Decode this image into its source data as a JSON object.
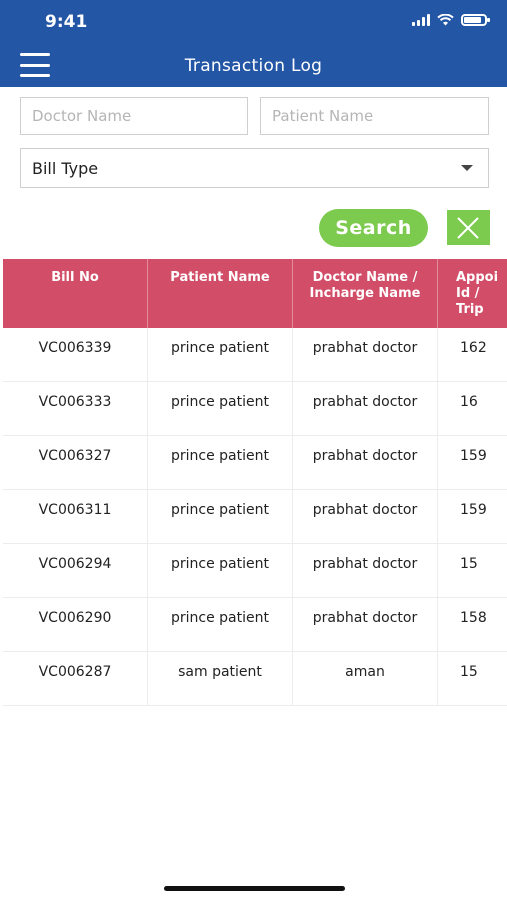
{
  "status": {
    "time": "9:41"
  },
  "header": {
    "title": "Transaction Log"
  },
  "filters": {
    "doctor_placeholder": "Doctor Name",
    "patient_placeholder": "Patient Name",
    "bill_type": "Bill Type"
  },
  "actions": {
    "search_label": "Search"
  },
  "colors": {
    "header": "#2456a6",
    "table_header": "#d24d68",
    "action_green": "#7ccb4e"
  },
  "table": {
    "columns": [
      "Bill No",
      "Patient Name",
      "Doctor Name / Incharge Name",
      "Appoi Id / Trip"
    ],
    "rows": [
      [
        "VC006339",
        "prince patient",
        "prabhat doctor",
        "162"
      ],
      [
        "VC006333",
        "prince patient",
        "prabhat doctor",
        "16"
      ],
      [
        "VC006327",
        "prince patient",
        "prabhat doctor",
        "159"
      ],
      [
        "VC006311",
        "prince patient",
        "prabhat doctor",
        "159"
      ],
      [
        "VC006294",
        "prince patient",
        "prabhat doctor",
        "15"
      ],
      [
        "VC006290",
        "prince patient",
        "prabhat doctor",
        "158"
      ],
      [
        "VC006287",
        "sam patient",
        "aman",
        "15"
      ]
    ]
  }
}
